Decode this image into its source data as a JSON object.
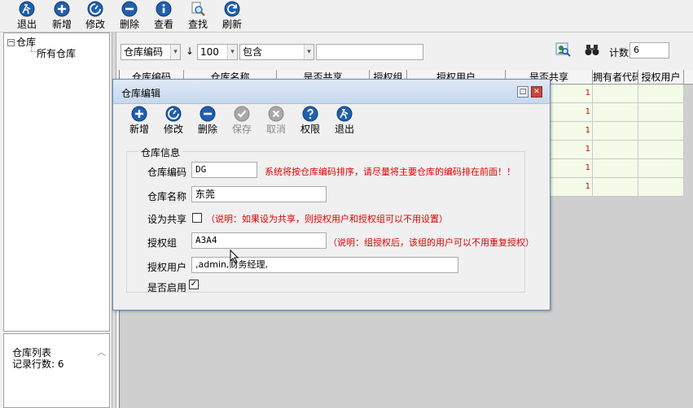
{
  "toolbar": {
    "buttons": [
      {
        "label": "退出",
        "icon": "exit-icon"
      },
      {
        "label": "新增",
        "icon": "add-icon"
      },
      {
        "label": "修改",
        "icon": "edit-icon"
      },
      {
        "label": "删除",
        "icon": "delete-icon"
      },
      {
        "label": "查看",
        "icon": "info-icon"
      },
      {
        "label": "查找",
        "icon": "search-icon"
      },
      {
        "label": "刷新",
        "icon": "refresh-icon"
      }
    ]
  },
  "tree": {
    "root_label": "仓库",
    "child_label": "所有仓库"
  },
  "info_panel": {
    "title": "仓库列表",
    "count_line": "记录行数: 6"
  },
  "filter": {
    "field": "仓库编码",
    "sort_arrow": "↓",
    "limit": "100",
    "operator": "包含",
    "value": "",
    "count_label": "计数",
    "count_value": "6"
  },
  "grid": {
    "columns": [
      "仓库编码",
      "仓库名称",
      "是否共享",
      "授权组",
      "授权用户",
      "是否共享",
      "拥有者代码",
      "授权用户"
    ],
    "rows": [
      {
        "flag": "1"
      },
      {
        "flag": "1"
      },
      {
        "flag": "1"
      },
      {
        "flag": "1"
      },
      {
        "flag": "1"
      },
      {
        "flag": "1"
      }
    ]
  },
  "dialog": {
    "title": "仓库编辑",
    "toolbar": [
      {
        "label": "新增",
        "icon": "add-icon",
        "enabled": true
      },
      {
        "label": "修改",
        "icon": "edit-icon",
        "enabled": true
      },
      {
        "label": "删除",
        "icon": "delete-icon",
        "enabled": true
      },
      {
        "label": "保存",
        "icon": "save-icon",
        "enabled": false
      },
      {
        "label": "取消",
        "icon": "cancel-icon",
        "enabled": false
      },
      {
        "label": "权限",
        "icon": "help-icon",
        "enabled": true
      },
      {
        "label": "退出",
        "icon": "exit-icon",
        "enabled": true
      }
    ],
    "group_title": "仓库信息",
    "fields": {
      "code_label": "仓库编码",
      "code_value": "DG",
      "code_note": "系统将按仓库编码排序，请尽量将主要仓库的编码排在前面！！",
      "name_label": "仓库名称",
      "name_value": "东莞",
      "share_label": "设为共享",
      "share_note": "（说明：如果设为共享，则授权用户和授权组可以不用设置）",
      "group_label": "授权组",
      "group_value": "A3A4",
      "group_note": "（说明：组授权后，该组的用户可以不用重复授权）",
      "user_label": "授权用户",
      "user_value": ",admin,财务经理,",
      "enabled_label": "是否启用"
    }
  },
  "colors": {
    "accent_blue": "#1f5fae",
    "note_red": "#e00000",
    "grid_cell": "#f5fbe9"
  }
}
